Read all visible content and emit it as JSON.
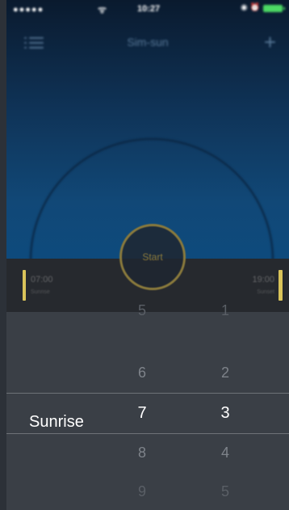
{
  "status_bar": {
    "signal": "●●●●●",
    "wifi": "ᯤ",
    "time": "10:27",
    "icons": "◉ ⏰"
  },
  "navbar": {
    "title": "Sim-sun",
    "add": "+"
  },
  "timebar": {
    "left_time": "07:00",
    "left_label": "Sunrise",
    "right_time": "19:00",
    "right_label": "Sunset"
  },
  "start_button": {
    "label": "Start"
  },
  "picker": {
    "selected_label": "Sunrise",
    "column_1": [
      "5",
      "6",
      "7",
      "8",
      "9"
    ],
    "column_2": [
      "1",
      "2",
      "3",
      "4",
      "5"
    ]
  },
  "colors": {
    "accent": "#d9c35a",
    "battery": "#4cd964",
    "picker_bg": "#3a3f46",
    "sky_top": "#0a1a2e",
    "sky_bottom": "#0e4a7c"
  }
}
